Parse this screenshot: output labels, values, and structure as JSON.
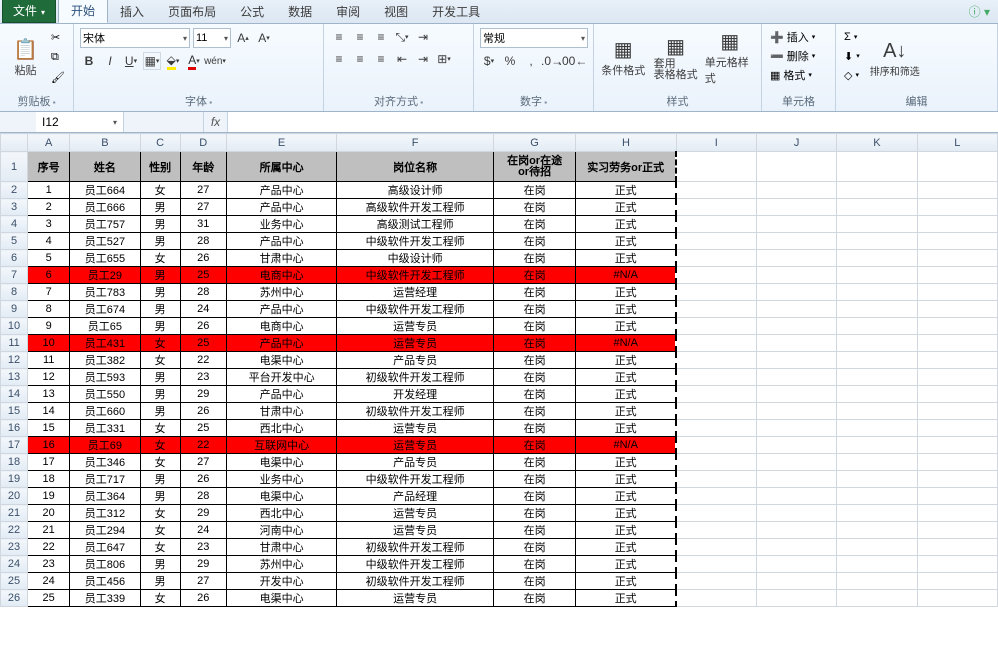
{
  "tabs": {
    "file": "文件",
    "home": "开始",
    "insert": "插入",
    "layout": "页面布局",
    "formula": "公式",
    "data": "数据",
    "review": "审阅",
    "view": "视图",
    "dev": "开发工具"
  },
  "ribbon": {
    "clipboard": {
      "paste": "粘贴",
      "label": "剪贴板"
    },
    "font": {
      "name": "宋体",
      "size": "11",
      "label": "字体"
    },
    "align": {
      "label": "对齐方式"
    },
    "number": {
      "format": "常规",
      "label": "数字"
    },
    "styles": {
      "cond": "条件格式",
      "table": "套用\n表格格式",
      "cell": "单元格样式",
      "label": "样式"
    },
    "cells": {
      "insert": "插入",
      "delete": "删除",
      "format": "格式",
      "label": "单元格"
    },
    "editing": {
      "sort": "排序和筛选",
      "label": "编辑"
    }
  },
  "namebox": "I12",
  "columns": [
    "A",
    "B",
    "C",
    "D",
    "E",
    "F",
    "G",
    "H",
    "I",
    "J",
    "K",
    "L"
  ],
  "headers": {
    "A": "序号",
    "B": "姓名",
    "C": "性别",
    "D": "年龄",
    "E": "所属中心",
    "F": "岗位名称",
    "G": "在岗or在途or待招",
    "H": "实习劳务or正式"
  },
  "chart_data": {
    "type": "table",
    "columns": [
      "序号",
      "姓名",
      "性别",
      "年龄",
      "所属中心",
      "岗位名称",
      "在岗or在途or待招",
      "实习劳务or正式"
    ],
    "rows": [
      {
        "n": 1,
        "name": "员工664",
        "sex": "女",
        "age": 27,
        "center": "产品中心",
        "post": "高级设计师",
        "status": "在岗",
        "type": "正式",
        "hl": false
      },
      {
        "n": 2,
        "name": "员工666",
        "sex": "男",
        "age": 27,
        "center": "产品中心",
        "post": "高级软件开发工程师",
        "status": "在岗",
        "type": "正式",
        "hl": false
      },
      {
        "n": 3,
        "name": "员工757",
        "sex": "男",
        "age": 31,
        "center": "业务中心",
        "post": "高级测试工程师",
        "status": "在岗",
        "type": "正式",
        "hl": false
      },
      {
        "n": 4,
        "name": "员工527",
        "sex": "男",
        "age": 28,
        "center": "产品中心",
        "post": "中级软件开发工程师",
        "status": "在岗",
        "type": "正式",
        "hl": false
      },
      {
        "n": 5,
        "name": "员工655",
        "sex": "女",
        "age": 26,
        "center": "甘肃中心",
        "post": "中级设计师",
        "status": "在岗",
        "type": "正式",
        "hl": false
      },
      {
        "n": 6,
        "name": "员工29",
        "sex": "男",
        "age": 25,
        "center": "电商中心",
        "post": "中级软件开发工程师",
        "status": "在岗",
        "type": "#N/A",
        "hl": true
      },
      {
        "n": 7,
        "name": "员工783",
        "sex": "男",
        "age": 28,
        "center": "苏州中心",
        "post": "运营经理",
        "status": "在岗",
        "type": "正式",
        "hl": false
      },
      {
        "n": 8,
        "name": "员工674",
        "sex": "男",
        "age": 24,
        "center": "产品中心",
        "post": "中级软件开发工程师",
        "status": "在岗",
        "type": "正式",
        "hl": false
      },
      {
        "n": 9,
        "name": "员工65",
        "sex": "男",
        "age": 26,
        "center": "电商中心",
        "post": "运营专员",
        "status": "在岗",
        "type": "正式",
        "hl": false
      },
      {
        "n": 10,
        "name": "员工431",
        "sex": "女",
        "age": 25,
        "center": "产品中心",
        "post": "运营专员",
        "status": "在岗",
        "type": "#N/A",
        "hl": true
      },
      {
        "n": 11,
        "name": "员工382",
        "sex": "女",
        "age": 22,
        "center": "电渠中心",
        "post": "产品专员",
        "status": "在岗",
        "type": "正式",
        "hl": false
      },
      {
        "n": 12,
        "name": "员工593",
        "sex": "男",
        "age": 23,
        "center": "平台开发中心",
        "post": "初级软件开发工程师",
        "status": "在岗",
        "type": "正式",
        "hl": false
      },
      {
        "n": 13,
        "name": "员工550",
        "sex": "男",
        "age": 29,
        "center": "产品中心",
        "post": "开发经理",
        "status": "在岗",
        "type": "正式",
        "hl": false
      },
      {
        "n": 14,
        "name": "员工660",
        "sex": "男",
        "age": 26,
        "center": "甘肃中心",
        "post": "初级软件开发工程师",
        "status": "在岗",
        "type": "正式",
        "hl": false
      },
      {
        "n": 15,
        "name": "员工331",
        "sex": "女",
        "age": 25,
        "center": "西北中心",
        "post": "运营专员",
        "status": "在岗",
        "type": "正式",
        "hl": false
      },
      {
        "n": 16,
        "name": "员工69",
        "sex": "女",
        "age": 22,
        "center": "互联网中心",
        "post": "运营专员",
        "status": "在岗",
        "type": "#N/A",
        "hl": true
      },
      {
        "n": 17,
        "name": "员工346",
        "sex": "女",
        "age": 27,
        "center": "电渠中心",
        "post": "产品专员",
        "status": "在岗",
        "type": "正式",
        "hl": false
      },
      {
        "n": 18,
        "name": "员工717",
        "sex": "男",
        "age": 26,
        "center": "业务中心",
        "post": "中级软件开发工程师",
        "status": "在岗",
        "type": "正式",
        "hl": false
      },
      {
        "n": 19,
        "name": "员工364",
        "sex": "男",
        "age": 28,
        "center": "电渠中心",
        "post": "产品经理",
        "status": "在岗",
        "type": "正式",
        "hl": false
      },
      {
        "n": 20,
        "name": "员工312",
        "sex": "女",
        "age": 29,
        "center": "西北中心",
        "post": "运营专员",
        "status": "在岗",
        "type": "正式",
        "hl": false
      },
      {
        "n": 21,
        "name": "员工294",
        "sex": "女",
        "age": 24,
        "center": "河南中心",
        "post": "运营专员",
        "status": "在岗",
        "type": "正式",
        "hl": false
      },
      {
        "n": 22,
        "name": "员工647",
        "sex": "女",
        "age": 23,
        "center": "甘肃中心",
        "post": "初级软件开发工程师",
        "status": "在岗",
        "type": "正式",
        "hl": false
      },
      {
        "n": 23,
        "name": "员工806",
        "sex": "男",
        "age": 29,
        "center": "苏州中心",
        "post": "中级软件开发工程师",
        "status": "在岗",
        "type": "正式",
        "hl": false
      },
      {
        "n": 24,
        "name": "员工456",
        "sex": "男",
        "age": 27,
        "center": "开发中心",
        "post": "初级软件开发工程师",
        "status": "在岗",
        "type": "正式",
        "hl": false
      },
      {
        "n": 25,
        "name": "员工339",
        "sex": "女",
        "age": 26,
        "center": "电渠中心",
        "post": "运营专员",
        "status": "在岗",
        "type": "正式",
        "hl": false
      }
    ]
  }
}
